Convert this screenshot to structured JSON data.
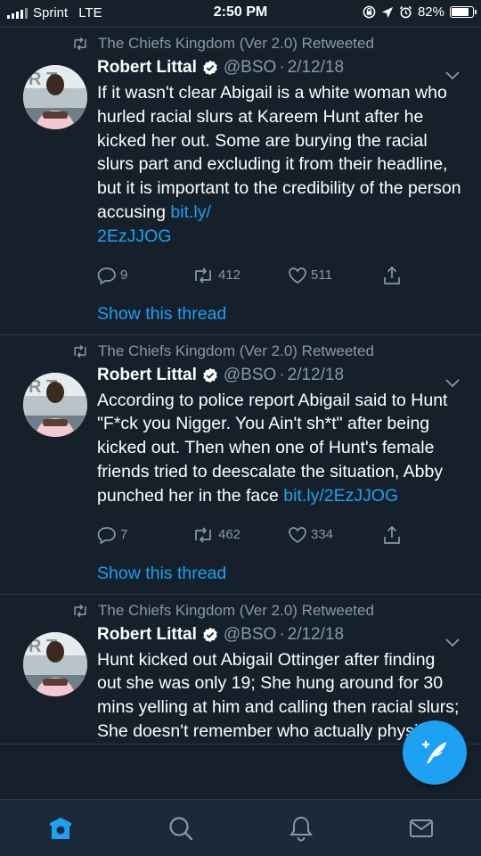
{
  "status_bar": {
    "carrier": "Sprint",
    "network": "LTE",
    "time": "2:50 PM",
    "battery": "82%",
    "battery_level": 0.82
  },
  "tweets": [
    {
      "retweeted_by": "The Chiefs Kingdom (Ver 2.0) Retweeted",
      "name": "Robert Littal",
      "handle": "@BSO",
      "date": "2/12/18",
      "text": "If it wasn't clear Abigail is a white woman who hurled racial slurs at Kareem Hunt after he kicked her out. Some are burying the racial slurs part and excluding it from their headline, but it is important to the credibility of the person accusing ",
      "link": "bit.ly/\n2EzJJOG",
      "replies": "9",
      "retweets": "412",
      "likes": "511",
      "show_thread": "Show this thread"
    },
    {
      "retweeted_by": "The Chiefs Kingdom (Ver 2.0) Retweeted",
      "name": "Robert Littal",
      "handle": "@BSO",
      "date": "2/12/18",
      "text": "According to police report Abigail said to Hunt \"F*ck you Nigger. You Ain't sh*t\" after being kicked out. Then when one of Hunt's female friends tried to deescalate the situation, Abby punched her in the face ",
      "link": "bit.ly/2EzJJOG",
      "replies": "7",
      "retweets": "462",
      "likes": "334",
      "show_thread": "Show this thread"
    },
    {
      "retweeted_by": "The Chiefs Kingdom (Ver 2.0) Retweeted",
      "name": "Robert Littal",
      "handle": "@BSO",
      "date": "2/12/18",
      "text": "Hunt kicked out Abigail Ottinger after finding out she was only 19; She hung around for 30 mins yelling at him and calling then racial slurs; She doesn't remember who actually physically",
      "link": ""
    }
  ],
  "colors": {
    "background": "#15202b",
    "accent": "#1da1f2",
    "secondary_text": "#8899a6",
    "tab_bar": "#1c2938"
  },
  "tabs": [
    {
      "icon": "home-icon",
      "active": true
    },
    {
      "icon": "search-icon",
      "active": false
    },
    {
      "icon": "notifications-bell-icon",
      "active": false
    },
    {
      "icon": "messages-envelope-icon",
      "active": false
    }
  ],
  "fab": {
    "icon": "compose-tweet-icon"
  }
}
